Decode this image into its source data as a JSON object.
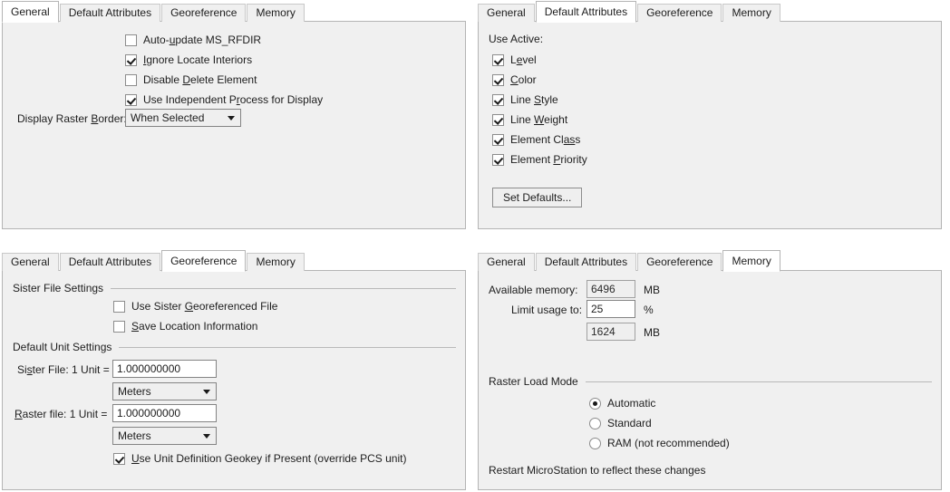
{
  "tabs": [
    "General",
    "Default Attributes",
    "Georeference",
    "Memory"
  ],
  "panel_general": {
    "active_tab": "General",
    "checkboxes": [
      {
        "label": "Auto-update MS_RFDIR",
        "checked": false,
        "mnemonic": "u"
      },
      {
        "label": "Ignore Locate Interiors",
        "checked": true,
        "mnemonic": "I"
      },
      {
        "label": "Disable Delete Element",
        "checked": false,
        "mnemonic": "D"
      },
      {
        "label": "Use Independent Process for Display",
        "checked": true,
        "mnemonic": "P"
      }
    ],
    "raster_border_label": "Display Raster Border:",
    "raster_border_value": "When Selected"
  },
  "panel_attributes": {
    "active_tab": "Default Attributes",
    "section_label": "Use Active:",
    "checkboxes": [
      {
        "label": "Level",
        "checked": true
      },
      {
        "label": "Color",
        "checked": true
      },
      {
        "label": "Line Style",
        "checked": true
      },
      {
        "label": "Line Weight",
        "checked": true
      },
      {
        "label": "Element Class",
        "checked": true
      },
      {
        "label": "Element Priority",
        "checked": true
      }
    ],
    "set_defaults_label": "Set Defaults..."
  },
  "panel_georeference": {
    "active_tab": "Georeference",
    "group_sister": "Sister File Settings",
    "sister_checkboxes": [
      {
        "label": "Use Sister Georeferenced File",
        "checked": false
      },
      {
        "label": "Save Location Information",
        "checked": false
      }
    ],
    "group_units": "Default Unit Settings",
    "sister_file_label": "Sister File: 1 Unit =",
    "sister_file_value": "1.000000000",
    "sister_file_unit": "Meters",
    "raster_file_label": "Raster file: 1 Unit =",
    "raster_file_value": "1.000000000",
    "raster_file_unit": "Meters",
    "geokey_label": "Use Unit Definition Geokey if Present (override PCS unit)",
    "geokey_checked": true
  },
  "panel_memory": {
    "active_tab": "Memory",
    "available_memory_label": "Available memory:",
    "available_memory_value": "6496",
    "available_memory_unit": "MB",
    "limit_usage_label": "Limit usage to:",
    "limit_usage_value": "25",
    "limit_usage_unit": "%",
    "limit_mb_value": "1624",
    "limit_mb_unit": "MB",
    "group_load_mode": "Raster Load Mode",
    "load_modes": [
      {
        "label": "Automatic",
        "selected": true
      },
      {
        "label": "Standard",
        "selected": false
      },
      {
        "label": "RAM (not recommended)",
        "selected": false
      }
    ],
    "restart_note": "Restart MicroStation to reflect these changes"
  },
  "colors": {
    "pane_bg": "#f0f0f0",
    "active_tab_bg": "#ffffff",
    "border": "#b4b4b4",
    "text": "#1d1d1d"
  }
}
